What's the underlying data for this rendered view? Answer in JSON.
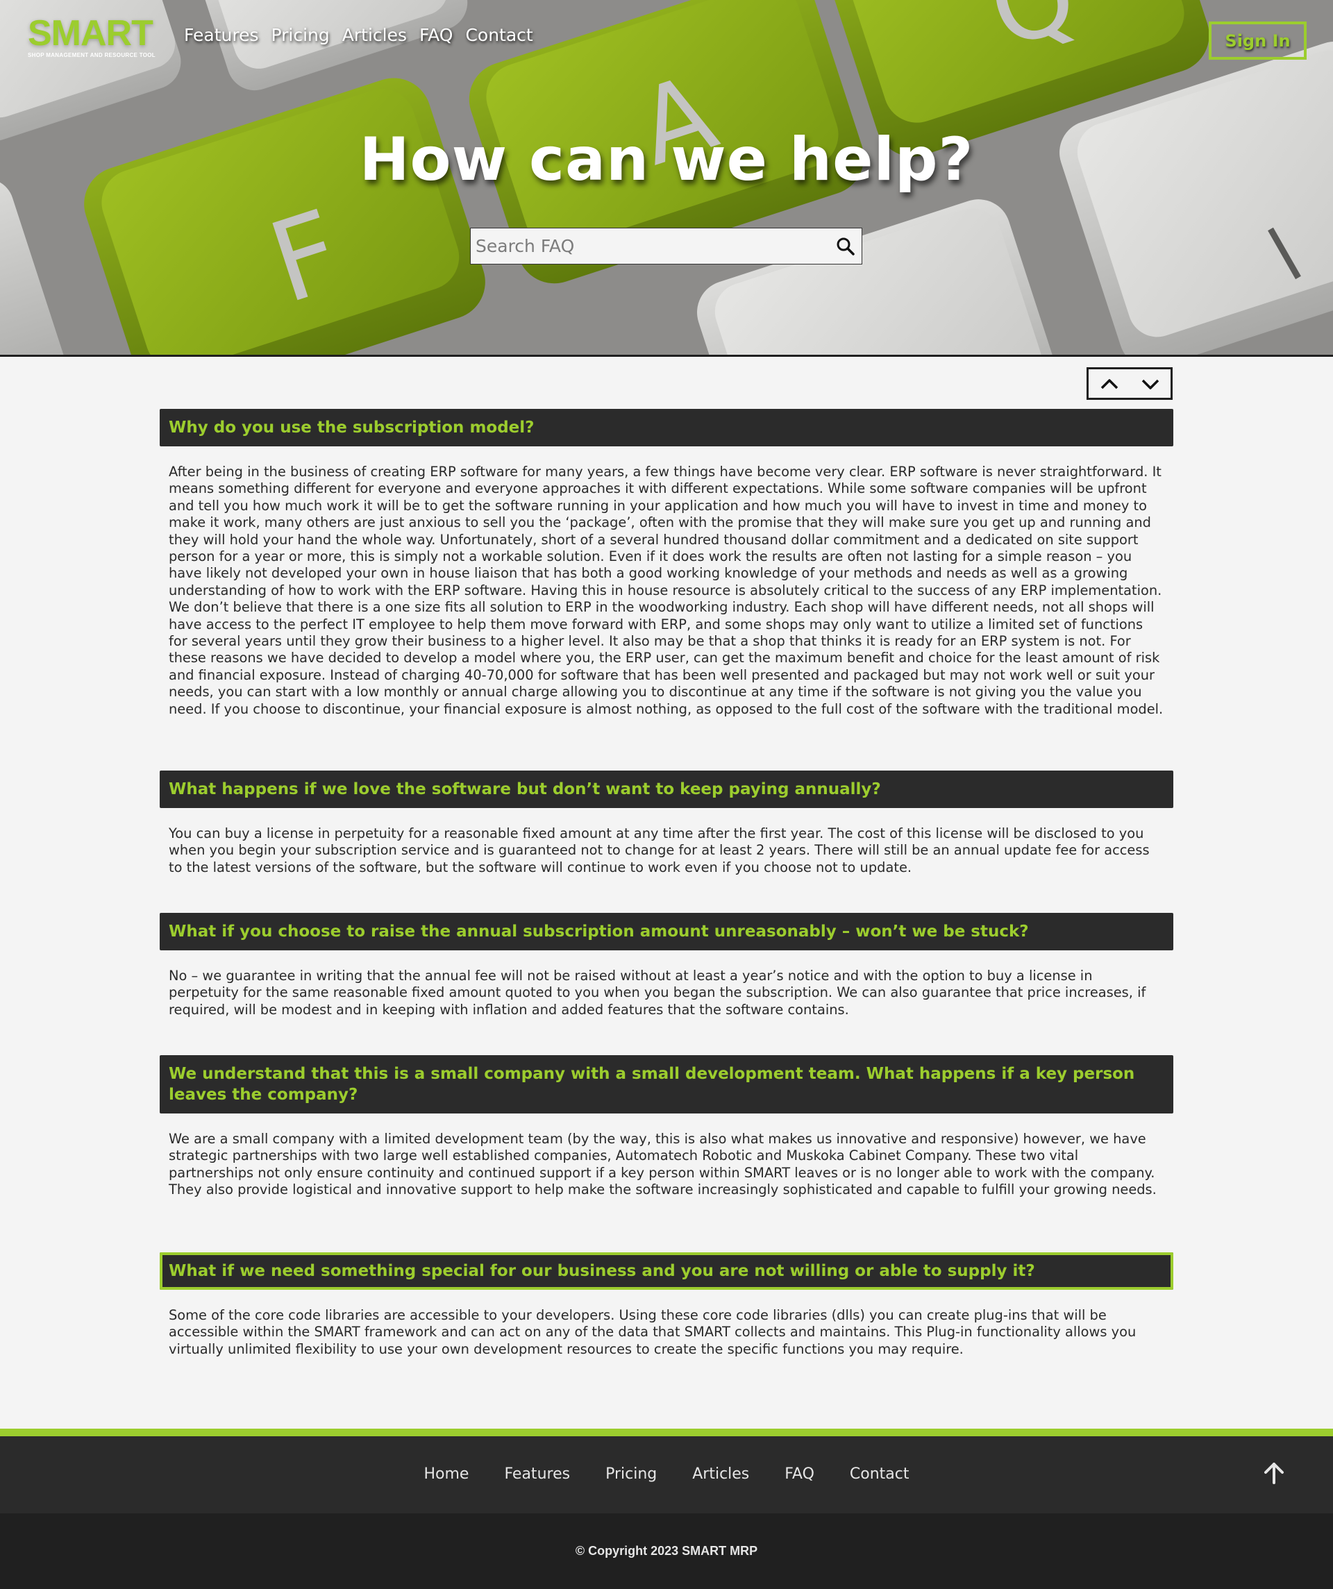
{
  "brand": {
    "logo_text": "SMART",
    "tagline": "SHOP MANAGEMENT AND RESOURCE TOOL",
    "accent_color": "#9ccd2e",
    "dark_color": "#2b2b2b"
  },
  "header": {
    "nav": [
      "Features",
      "Pricing",
      "Articles",
      "FAQ",
      "Contact"
    ],
    "sign_in_label": "Sign In"
  },
  "hero": {
    "background_keycaps": [
      "F",
      "A",
      "Q"
    ],
    "title": "How can we help?",
    "search_placeholder": "Search FAQ",
    "search_icon": "search-icon"
  },
  "controls": {
    "collapse_icon": "chevron-up-icon",
    "expand_icon": "chevron-down-icon"
  },
  "faqs": [
    {
      "question": "Why do you use the subscription model?",
      "answer": "After being in the business of creating ERP software for many years, a few things have become very clear. ERP software is never straightforward. It means something different for everyone and everyone approaches it with different expectations. While some software companies will be upfront and tell you how much work it will be to get the software running in your application and how much you will have to invest in time and money to make it work, many others are just anxious to sell you the ‘package’, often with the promise that they will make sure you get up and running and they will hold your hand the whole way. Unfortunately, short of a several hundred thousand dollar commitment and a dedicated on site support person for a year or more, this is simply not a workable solution. Even if it does work the results are often not lasting for a simple reason – you have likely not developed your own in house liaison that has both a good working knowledge of your methods and needs as well as a growing understanding of how to work with the ERP software. Having this in house resource is absolutely critical to the success of any ERP implementation. We don’t believe that there is a one size fits all solution to ERP in the woodworking industry. Each shop will have different needs, not all shops will have access to the perfect IT employee to help them move forward with ERP, and some shops may only want to utilize a limited set of functions for several years until they grow their business to a higher level. It also may be that a shop that thinks it is ready for an ERP system is not. For these reasons we have decided to develop a model where you, the ERP user, can get the maximum benefit and choice for the least amount of risk and financial exposure. Instead of charging 40-70,000 for software that has been well presented and packaged but may not work well or suit your needs, you can start with a low monthly or annual charge allowing you to discontinue at any time if the software is not giving you the value you need. If you choose to discontinue, your financial exposure is almost nothing, as opposed to the full cost of the software with the traditional model."
    },
    {
      "question": "What happens if we love the software but don’t want to keep paying annually?",
      "answer": "You can buy a license in perpetuity for a reasonable fixed amount at any time after the first year. The cost of this license will be disclosed to you when you begin your subscription service and is guaranteed not to change for at least 2 years. There will still be an annual update fee for access to the latest versions of the software, but the software will continue to work even if you choose not to update."
    },
    {
      "question": "What if you choose to raise the annual subscription amount unreasonably – won’t we be stuck?",
      "answer": "No – we guarantee in writing that the annual fee will not be raised without at least a year’s notice and with the option to buy a license in perpetuity for the same reasonable fixed amount quoted to you when you began the subscription. We can also guarantee that price increases, if required, will be modest and in keeping with inflation and added features that the software contains."
    },
    {
      "question": "We understand that this is a small company with a small development team. What happens if a key person leaves the company?",
      "answer": "We are a small company with a limited development team (by the way, this is also what makes us innovative and responsive) however, we have strategic partnerships with two large well established companies, Automatech Robotic and Muskoka Cabinet Company. These two vital partnerships not only ensure continuity and continued support if a key person within SMART leaves or is no longer able to work with the company. They also provide logistical and innovative support to help make the software increasingly sophisticated and capable to fulfill your growing needs."
    },
    {
      "question": "What if we need something special for our business and you are not willing or able to supply it?",
      "answer": "Some of the core code libraries are accessible to your developers. Using these core code libraries (dlls) you can create plug-ins that will be accessible within the SMART framework and can act on any of the data that SMART collects and maintains. This Plug-in functionality allows you virtually unlimited flexibility to use your own development resources to create the specific functions you may require."
    }
  ],
  "footer": {
    "nav": [
      "Home",
      "Features",
      "Pricing",
      "Articles",
      "FAQ",
      "Contact"
    ],
    "back_to_top_icon": "arrow-up-icon",
    "copyright": "© Copyright 2023 SMART MRP"
  }
}
